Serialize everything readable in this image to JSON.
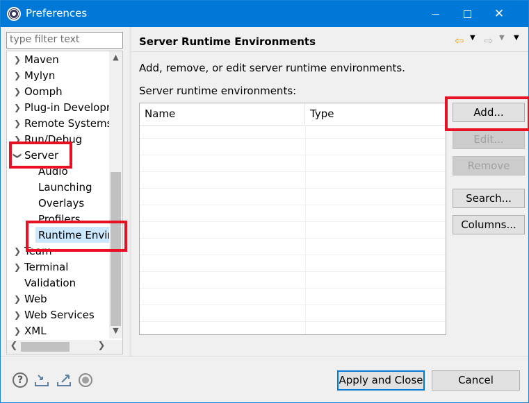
{
  "window": {
    "title": "Preferences",
    "minimize_glyph": "—",
    "maximize_glyph": "□",
    "close_glyph": "✕"
  },
  "filter": {
    "placeholder": "type filter text"
  },
  "tree": {
    "items": [
      {
        "label": "Maven",
        "expandable": true,
        "expanded": false,
        "level": 0
      },
      {
        "label": "Mylyn",
        "expandable": true,
        "expanded": false,
        "level": 0
      },
      {
        "label": "Oomph",
        "expandable": true,
        "expanded": false,
        "level": 0
      },
      {
        "label": "Plug-in Developr",
        "expandable": true,
        "expanded": false,
        "level": 0
      },
      {
        "label": "Remote Systems",
        "expandable": true,
        "expanded": false,
        "level": 0
      },
      {
        "label": "Run/Debug",
        "expandable": true,
        "expanded": false,
        "level": 0
      },
      {
        "label": "Server",
        "expandable": true,
        "expanded": true,
        "level": 0
      },
      {
        "label": "Audio",
        "expandable": false,
        "level": 1
      },
      {
        "label": "Launching",
        "expandable": false,
        "level": 1
      },
      {
        "label": "Overlays",
        "expandable": false,
        "level": 1
      },
      {
        "label": "Profilers",
        "expandable": false,
        "level": 1
      },
      {
        "label": "Runtime Envir",
        "expandable": false,
        "level": 1,
        "selected": true
      },
      {
        "label": "Team",
        "expandable": true,
        "expanded": false,
        "level": 0
      },
      {
        "label": "Terminal",
        "expandable": true,
        "expanded": false,
        "level": 0
      },
      {
        "label": "Validation",
        "expandable": false,
        "level": 0
      },
      {
        "label": "Web",
        "expandable": true,
        "expanded": false,
        "level": 0
      },
      {
        "label": "Web Services",
        "expandable": true,
        "expanded": false,
        "level": 0
      },
      {
        "label": "XML",
        "expandable": true,
        "expanded": false,
        "level": 0
      }
    ]
  },
  "page": {
    "title": "Server Runtime Environments",
    "description": "Add, remove, or edit server runtime environments.",
    "table_label": "Server runtime environments:",
    "columns": [
      "Name",
      "Type"
    ],
    "rows": []
  },
  "buttons": {
    "add": "Add...",
    "edit": "Edit...",
    "remove": "Remove",
    "search": "Search...",
    "columns": "Columns..."
  },
  "footer": {
    "help_glyph": "?",
    "apply_close": "Apply and Close",
    "cancel": "Cancel"
  },
  "colors": {
    "titlebar": "#0078d7",
    "highlight_box": "#e81123",
    "selection": "#cce8ff"
  }
}
